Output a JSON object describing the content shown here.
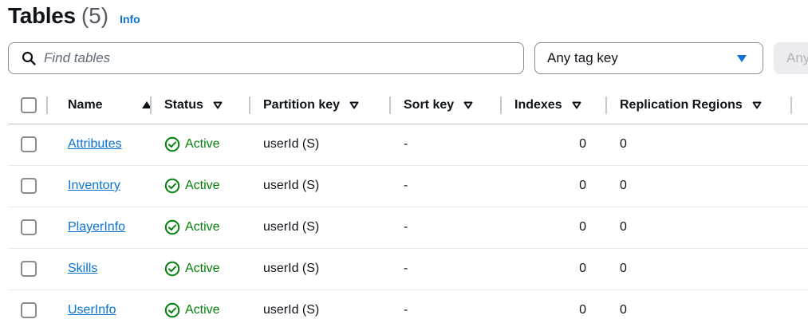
{
  "header": {
    "title": "Tables",
    "count": "(5)",
    "info_label": "Info"
  },
  "search": {
    "placeholder": "Find tables"
  },
  "tag_key_select": {
    "value": "Any tag key"
  },
  "tag_value_select": {
    "value": "Any"
  },
  "columns": {
    "name": "Name",
    "status": "Status",
    "partition_key": "Partition key",
    "sort_key": "Sort key",
    "indexes": "Indexes",
    "replication_regions": "Replication Regions"
  },
  "rows": [
    {
      "name": "Attributes",
      "status": "Active",
      "partition_key": "userId (S)",
      "sort_key": "-",
      "indexes": "0",
      "replication_regions": "0"
    },
    {
      "name": "Inventory",
      "status": "Active",
      "partition_key": "userId (S)",
      "sort_key": "-",
      "indexes": "0",
      "replication_regions": "0"
    },
    {
      "name": "PlayerInfo",
      "status": "Active",
      "partition_key": "userId (S)",
      "sort_key": "-",
      "indexes": "0",
      "replication_regions": "0"
    },
    {
      "name": "Skills",
      "status": "Active",
      "partition_key": "userId (S)",
      "sort_key": "-",
      "indexes": "0",
      "replication_regions": "0"
    },
    {
      "name": "UserInfo",
      "status": "Active",
      "partition_key": "userId (S)",
      "sort_key": "-",
      "indexes": "0",
      "replication_regions": "0"
    }
  ],
  "colors": {
    "link": "#0972d3",
    "success": "#037f0c",
    "text": "#0f141a"
  },
  "icons": {
    "search": "search-icon",
    "status": "check-circle-icon",
    "sort_asc": "sort-ascending-icon",
    "sort": "sort-icon"
  }
}
